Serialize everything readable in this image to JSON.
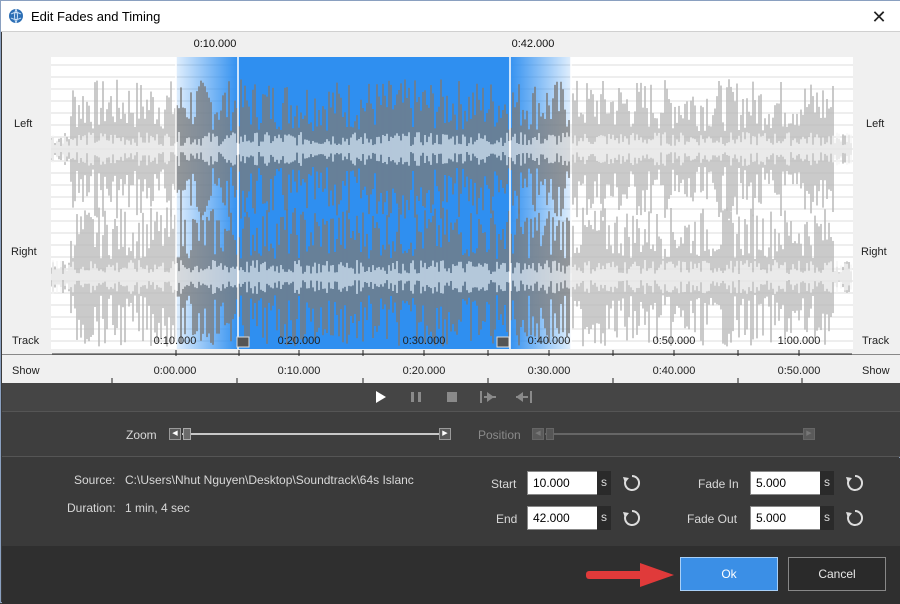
{
  "window": {
    "title": "Edit Fades and Timing",
    "close_glyph": "✕"
  },
  "waveform": {
    "channels": [
      "Left",
      "Right"
    ],
    "start_marker": "0:10.000",
    "end_marker": "0:42.000"
  },
  "track_ruler": {
    "label": "Track",
    "ticks": [
      "0:10.000",
      "0:20.000",
      "0:30.000",
      "0:40.000",
      "0:50.000",
      "1:00.000"
    ]
  },
  "show_ruler": {
    "label": "Show",
    "ticks": [
      "0:00.000",
      "0:10.000",
      "0:20.000",
      "0:30.000",
      "0:40.000",
      "0:50.000"
    ]
  },
  "transport": {
    "play": "play-icon",
    "pause": "pause-icon",
    "stop": "stop-icon",
    "goto_start": "goto-start-icon",
    "goto_end": "goto-end-icon"
  },
  "zoom": {
    "label": "Zoom"
  },
  "position": {
    "label": "Position"
  },
  "details": {
    "source_label": "Source:",
    "source_value": "C:\\Users\\Nhut Nguyen\\Desktop\\Soundtrack\\64s Islanc",
    "duration_label": "Duration:",
    "duration_value": "1 min, 4 sec",
    "start_label": "Start",
    "start_value": "10.000",
    "end_label": "End",
    "end_value": "42.000",
    "fade_in_label": "Fade In",
    "fade_in_value": "5.000",
    "fade_out_label": "Fade Out",
    "fade_out_value": "5.000",
    "unit": "s"
  },
  "footer": {
    "ok_label": "Ok",
    "cancel_label": "Cancel"
  },
  "colors": {
    "selection": "#2f8ff0",
    "ok_button": "#3b8fe6",
    "arrow": "#e03a3a"
  }
}
